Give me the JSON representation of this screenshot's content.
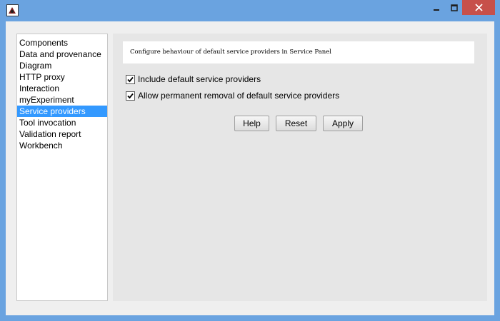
{
  "window": {
    "icon": "java-app-icon",
    "controls": {
      "minimize": "minimize-icon",
      "maximize": "maximize-icon",
      "close": "close-icon"
    },
    "colors": {
      "frame": "#6aa3e0",
      "close": "#c7504a"
    }
  },
  "sidebar": {
    "items": [
      {
        "label": "Components"
      },
      {
        "label": "Data and provenance"
      },
      {
        "label": "Diagram"
      },
      {
        "label": "HTTP proxy"
      },
      {
        "label": "Interaction"
      },
      {
        "label": "myExperiment"
      },
      {
        "label": "Service providers",
        "selected": true
      },
      {
        "label": "Tool invocation"
      },
      {
        "label": "Validation report"
      },
      {
        "label": "Workbench"
      }
    ],
    "selected_color": "#3399ff"
  },
  "panel": {
    "description": "Configure behaviour of default service providers in Service Panel",
    "options": [
      {
        "label": "Include default service providers",
        "checked": true
      },
      {
        "label": "Allow permanent removal of default service providers",
        "checked": true
      }
    ],
    "buttons": {
      "help": "Help",
      "reset": "Reset",
      "apply": "Apply"
    }
  }
}
